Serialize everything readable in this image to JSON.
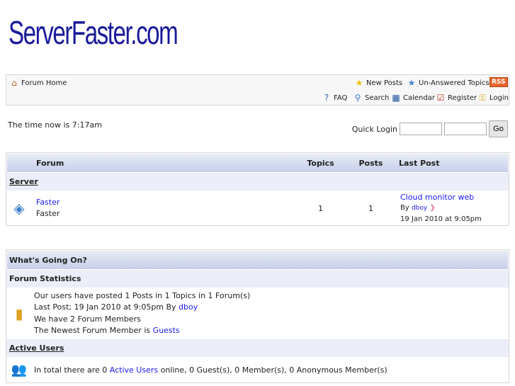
{
  "logo": "ServerFaster.com",
  "nav": {
    "forum_home": "Forum Home",
    "new_posts": "New Posts",
    "unanswered": "Un-Answered Topics",
    "rss": "RSS",
    "faq": "FAQ",
    "search": "Search",
    "calendar": "Calendar",
    "register": "Register",
    "login": "Login"
  },
  "time_text": "The time now is 7:17am",
  "quick_login": {
    "label": "Quick Login",
    "go": "Go"
  },
  "forum_table": {
    "headers": {
      "forum": "Forum",
      "topics": "Topics",
      "posts": "Posts",
      "last_post": "Last Post"
    },
    "category": "Server",
    "forums": [
      {
        "name": "Faster",
        "description": "Faster",
        "topics": "1",
        "posts": "1",
        "last_post_title": "Cloud monitor web",
        "by": "By",
        "last_post_user": "dboy",
        "last_post_date": "19 Jan 2010 at 9:05pm"
      }
    ]
  },
  "stats": {
    "title": "What's Going On?",
    "forum_statistics": "Forum Statistics",
    "line1": "Our users have posted 1 Posts in 1 Topics in 1 Forum(s)",
    "line2_prefix": "Last Post; 19 Jan 2010 at 9:05pm By",
    "line2_user": "dboy",
    "line3": "We have 2 Forum Members",
    "line4_prefix": "The Newest Forum Member is",
    "line4_user": "Guests",
    "active_users": "Active Users",
    "active_prefix": "In total there are 0",
    "active_link": "Active Users",
    "active_suffix": "online, 0 Guest(s), 0 Member(s), 0 Anonymous Member(s)"
  }
}
